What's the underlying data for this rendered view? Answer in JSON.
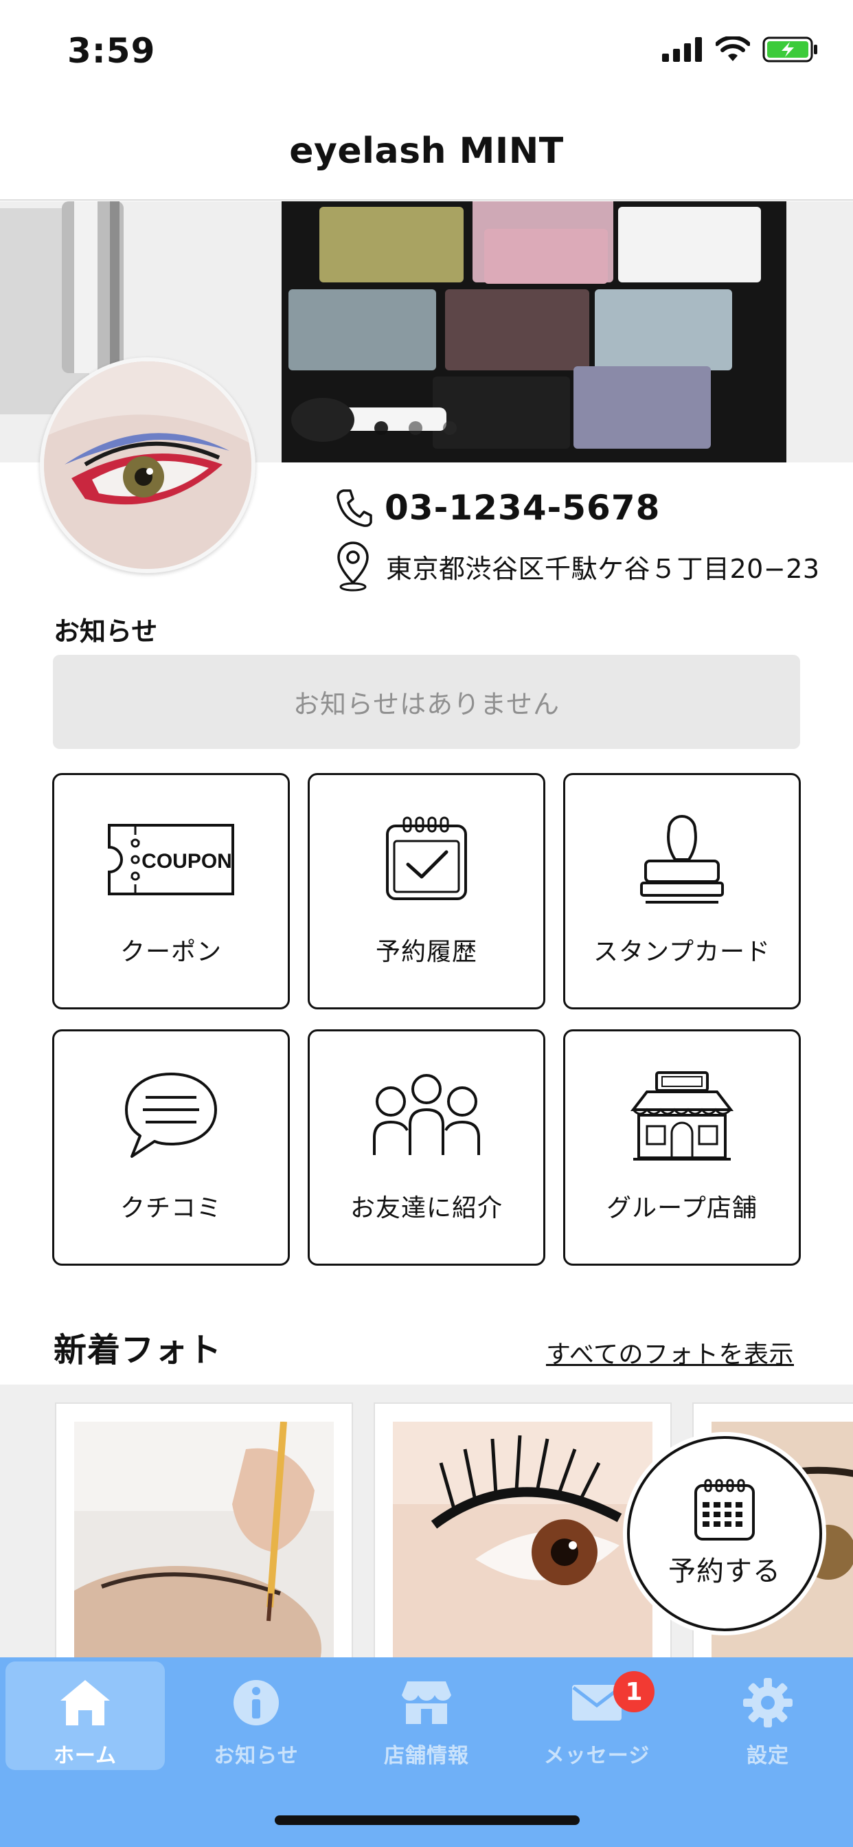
{
  "status_bar": {
    "time": "3:59"
  },
  "header": {
    "title": "eyelash MINT"
  },
  "hero": {
    "slides": 3,
    "active_slide": 1
  },
  "contact": {
    "phone": "03-1234-5678",
    "address": "東京都渋谷区千駄ケ谷５丁目20−23"
  },
  "notice": {
    "title": "お知らせ",
    "empty_text": "お知らせはありません"
  },
  "menu": [
    {
      "label": "クーポン",
      "icon": "coupon-icon",
      "coupon_text": "COUPON"
    },
    {
      "label": "予約履歴",
      "icon": "calendar-check-icon"
    },
    {
      "label": "スタンプカード",
      "icon": "stamp-icon"
    },
    {
      "label": "クチコミ",
      "icon": "speech-bubble-icon"
    },
    {
      "label": "お友達に紹介",
      "icon": "people-icon"
    },
    {
      "label": "グループ店舗",
      "icon": "store-icon"
    }
  ],
  "photos": {
    "title": "新着フォト",
    "link": "すべてのフォトを表示"
  },
  "fab": {
    "label": "予約する"
  },
  "tabbar": {
    "items": [
      {
        "label": "ホーム",
        "icon": "home-icon",
        "active": true
      },
      {
        "label": "お知らせ",
        "icon": "info-icon"
      },
      {
        "label": "店舗情報",
        "icon": "shop-icon"
      },
      {
        "label": "メッセージ",
        "icon": "mail-icon",
        "badge": "1"
      },
      {
        "label": "設定",
        "icon": "gear-icon"
      }
    ]
  },
  "colors": {
    "tabbar": "#6fb0f7",
    "badge": "#f23a33",
    "battery": "#3ccb3a"
  }
}
